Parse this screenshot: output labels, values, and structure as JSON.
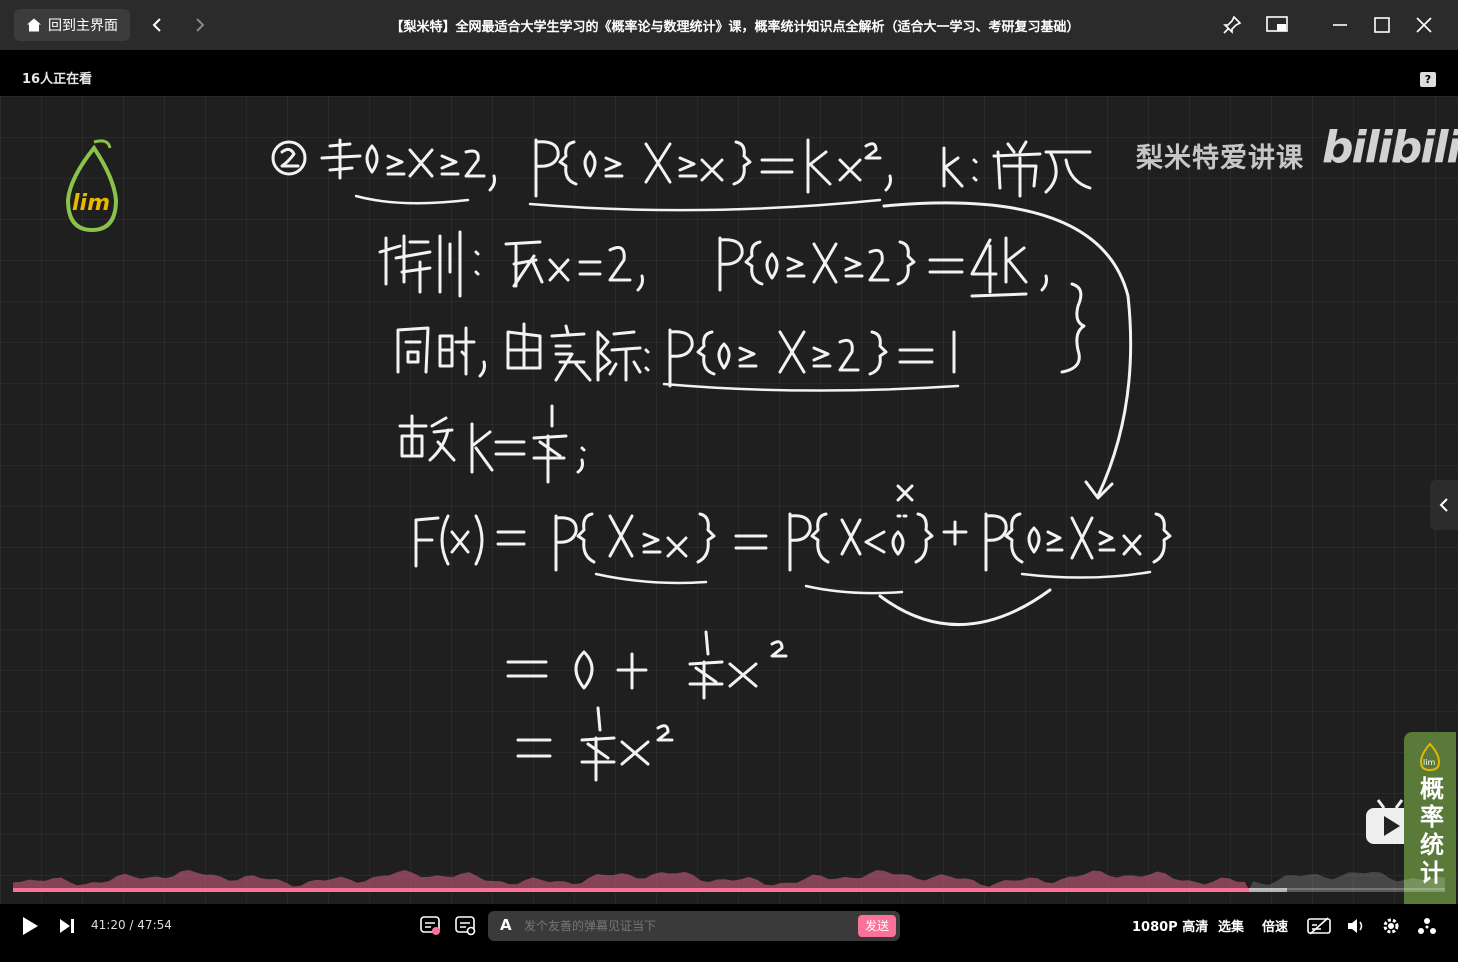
{
  "titlebar": {
    "home_label": "回到主界面",
    "title": "【梨米特】全网最适合大学生学习的《概率论与数理统计》课，概率统计知识点全解析（适合大一学习、考研复习基础）"
  },
  "infobar": {
    "viewers": "16人正在看",
    "help": "?"
  },
  "video": {
    "watermark": "梨米特爱讲课",
    "platform_logo": "bilibili",
    "promo_text": "概率统计"
  },
  "player": {
    "current_time": "41:20",
    "separator": "/",
    "duration": "47:54",
    "progress": 0.863,
    "buffered": 0.89,
    "danmaku_placeholder": "发个友善的弹幕见证当下",
    "send_label": "发送",
    "quality": "1080P 高清",
    "episodes": "选集",
    "speed": "倍速",
    "accent_color": "#fb7299"
  }
}
